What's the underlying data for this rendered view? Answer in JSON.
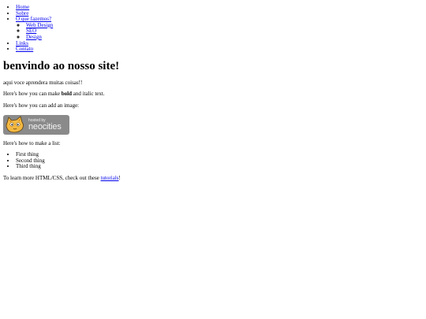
{
  "nav": {
    "home": "Home",
    "sobre": "Sobre",
    "oque": "O que fazemos?",
    "sub": [
      "Web Design",
      "SEO",
      "Design"
    ],
    "links": "Links",
    "contato": "Contato"
  },
  "heading": "benvindo ao nosso site!",
  "intro": "aqui voce aprendera muitas coisas!!",
  "bold_line": {
    "before": "Here's how you can make ",
    "bold": "bold",
    "after": " and italic text."
  },
  "image_line": "Here's how you can add an image:",
  "badge": {
    "small": "hosted by",
    "big": "neocities"
  },
  "list_intro": "Here's how to make a list:",
  "list": [
    "First thing",
    "Second thing",
    "Third thing"
  ],
  "footer": {
    "before": "To learn more HTML/CSS, check out these ",
    "link": "tutorials",
    "after": "!"
  }
}
